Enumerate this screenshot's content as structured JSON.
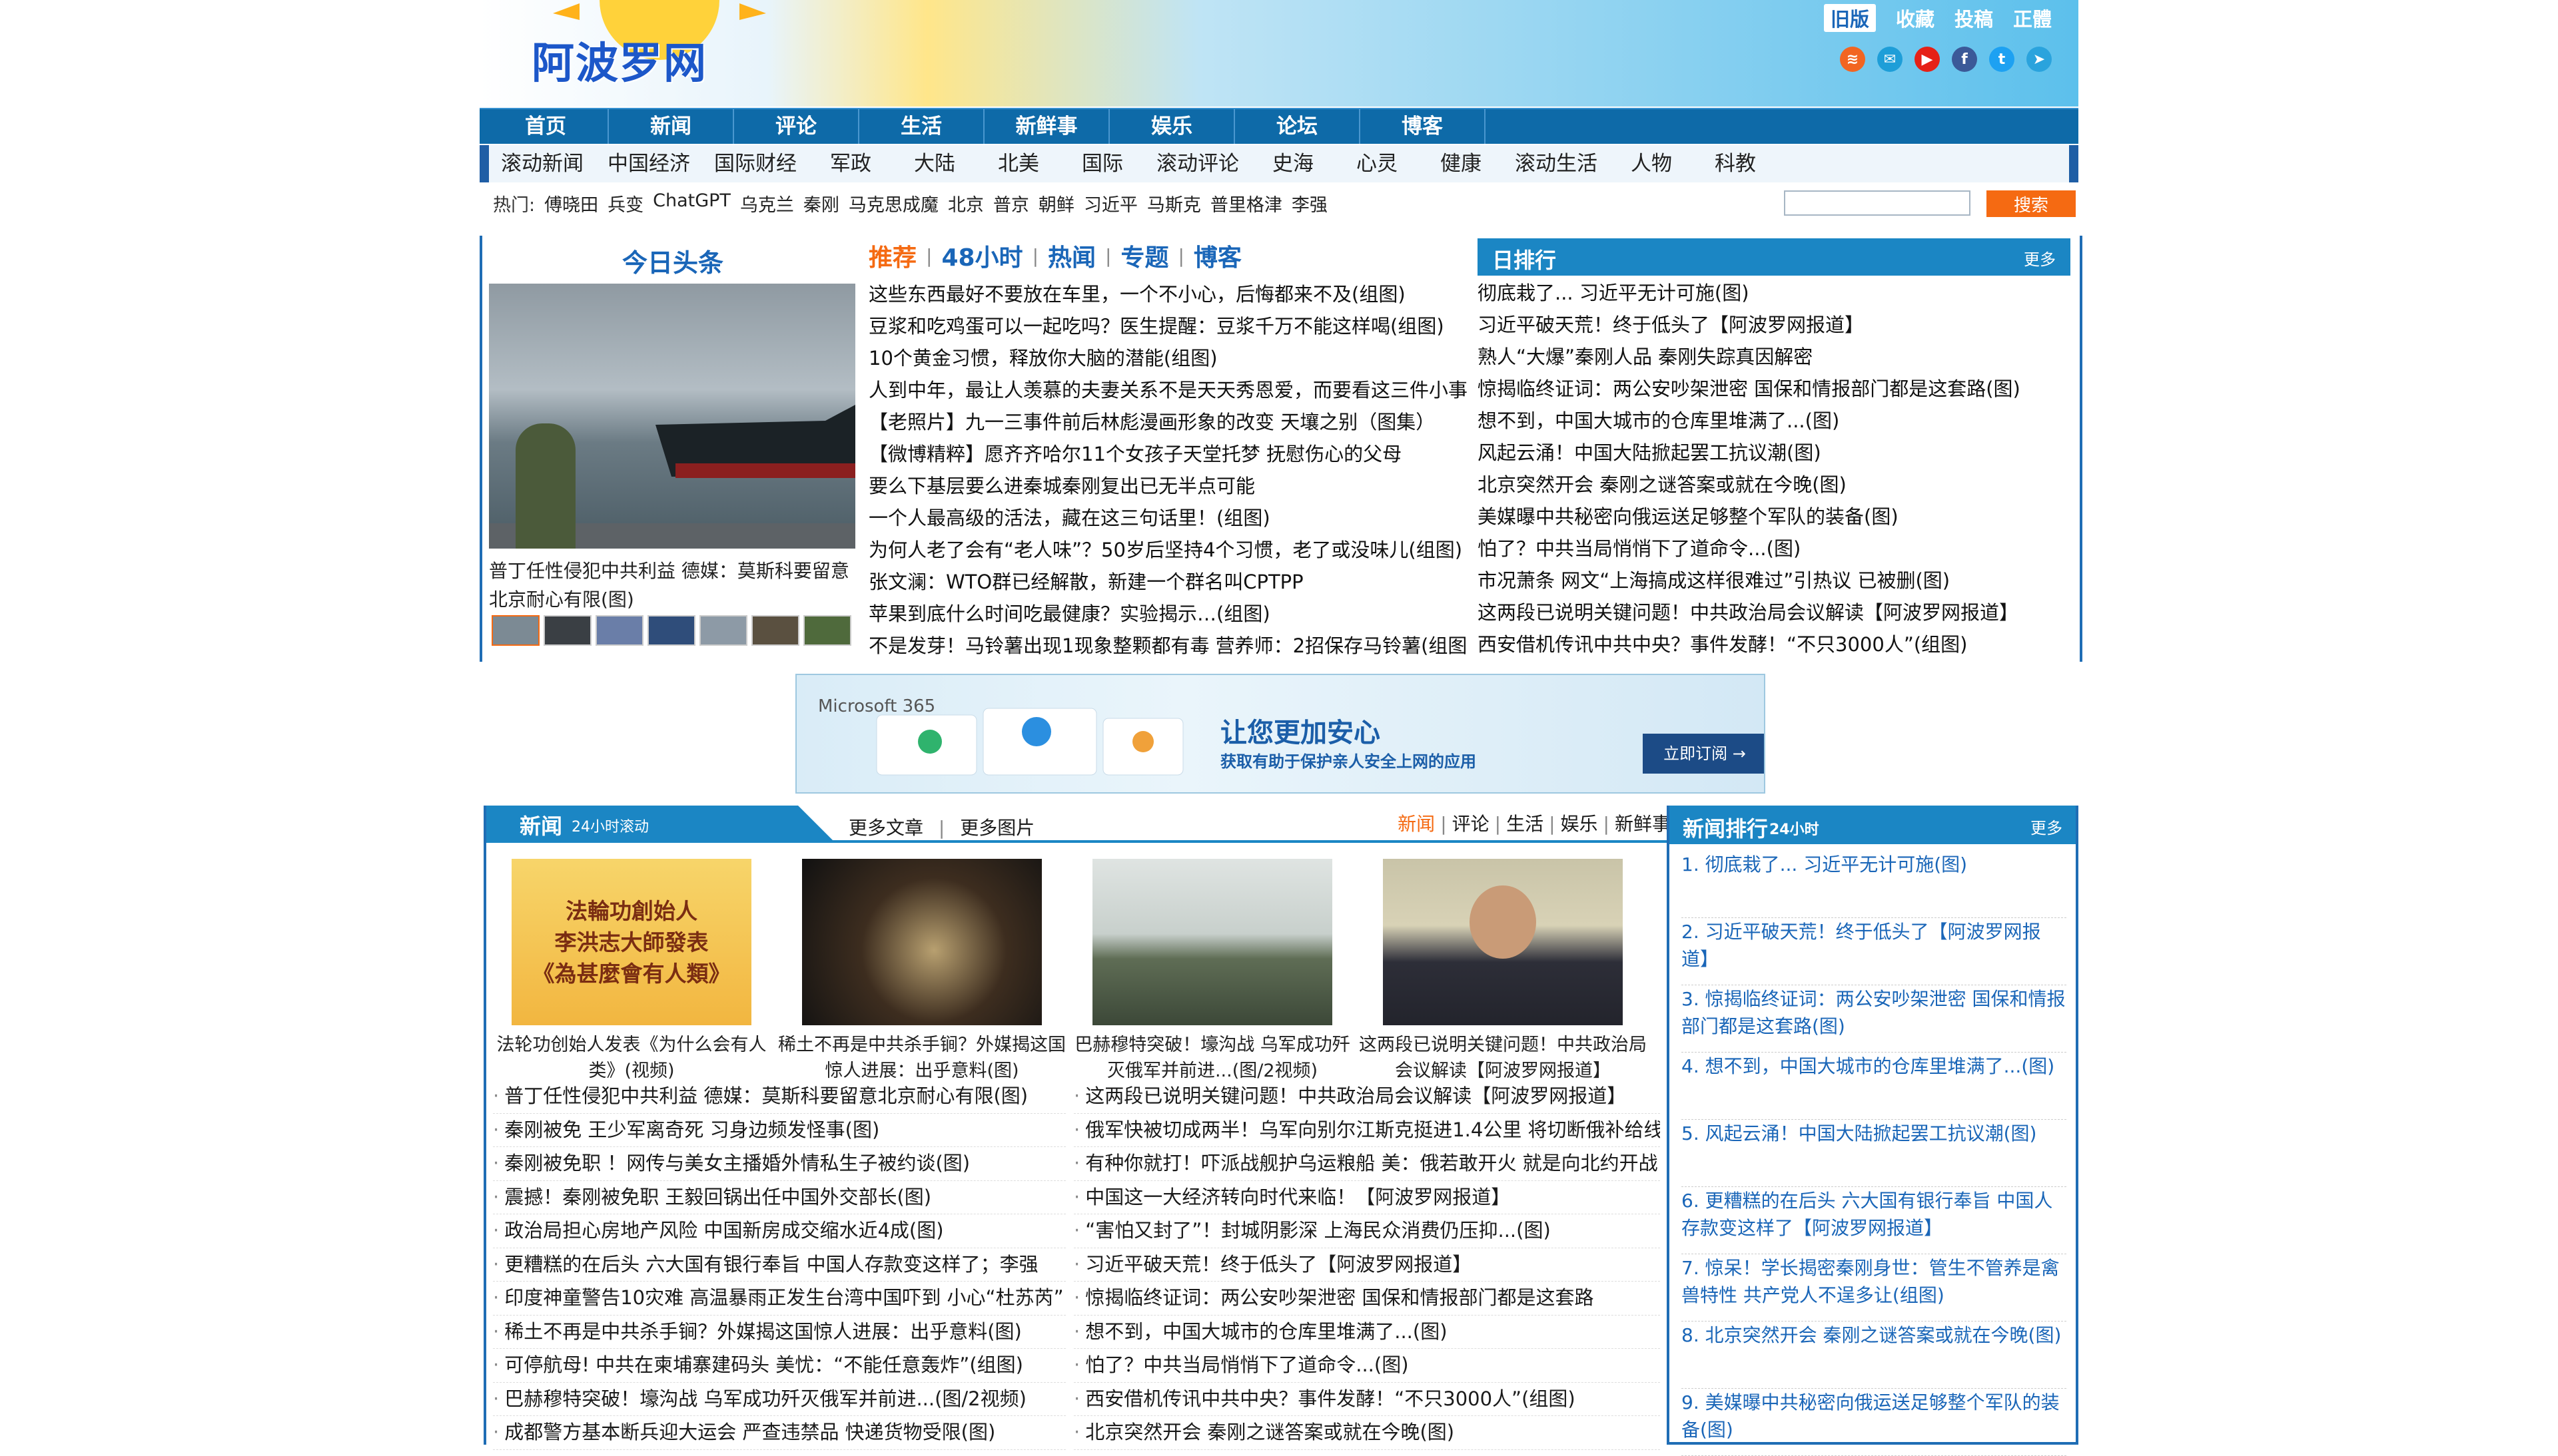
{
  "header": {
    "logo": "阿波罗网",
    "toplinks": [
      "旧版",
      "收藏",
      "投稿",
      "正體"
    ],
    "socials": [
      {
        "icon": "rss-icon",
        "glyph": "≋",
        "color": "#f26522"
      },
      {
        "icon": "telegram-circle-icon",
        "glyph": "✉",
        "color": "#1e9ed8"
      },
      {
        "icon": "youtube-icon",
        "glyph": "▶",
        "color": "#e62117"
      },
      {
        "icon": "facebook-icon",
        "glyph": "f",
        "color": "#3b5998"
      },
      {
        "icon": "twitter-icon",
        "glyph": "t",
        "color": "#1da1f2"
      },
      {
        "icon": "telegram-icon",
        "glyph": "➤",
        "color": "#2aa3dd"
      }
    ]
  },
  "nav": [
    "首页",
    "新闻",
    "评论",
    "生活",
    "新鲜事",
    "娱乐",
    "论坛",
    "博客"
  ],
  "subnav": [
    "滚动新闻",
    "中国经济",
    "国际财经",
    "军政",
    "大陆",
    "北美",
    "国际",
    "滚动评论",
    "史海",
    "心灵",
    "健康",
    "滚动生活",
    "人物",
    "科教"
  ],
  "hot": {
    "label": "热门:",
    "items": [
      "傅晓田",
      "兵变",
      "ChatGPT",
      "乌克兰",
      "秦刚",
      "马克思成魔",
      "北京",
      "普京",
      "朝鲜",
      "习近平",
      "马斯克",
      "普里格津",
      "李强"
    ],
    "search_button": "搜索"
  },
  "headline": {
    "title": "今日头条",
    "caption": "普丁任性侵犯中共利益 德媒：莫斯科要留意北京耐心有限(图)"
  },
  "mid": {
    "tabs": [
      "推荐",
      "48小时",
      "热闻",
      "专题",
      "博客"
    ],
    "items": [
      "这些东西最好不要放在车里，一个不小心，后悔都来不及(组图)",
      "豆浆和吃鸡蛋可以一起吃吗？医生提醒：豆浆千万不能这样喝(组图)",
      "10个黄金习惯，释放你大脑的潜能(组图)",
      "人到中年，最让人羡慕的夫妻关系不是天天秀恩爱，而要看这三件小事",
      "【老照片】九一三事件前后林彪漫画形象的改变 天壤之别（图集）",
      "【微博精粹】愿齐齐哈尔11个女孩子天堂托梦 抚慰伤心的父母",
      "要么下基层要么进秦城秦刚复出已无半点可能",
      "一个人最高级的活法，藏在这三句话里！(组图)",
      "为何人老了会有“老人味”？50岁后坚持4个习惯，老了或没味儿(组图)",
      "张文澜：WTO群已经解散，新建一个群名叫CPTPP",
      "苹果到底什么时间吃最健康？实验揭示…(组图)",
      "不是发芽！马铃薯出现1现象整颗都有毒 营养师：2招保存马铃薯(组图)"
    ]
  },
  "daily_rank": {
    "title": "日排行",
    "more": "更多",
    "items": [
      "彻底栽了... 习近平无计可施(图)",
      "习近平破天荒！终于低头了【阿波罗网报道】",
      "熟人“大爆”秦刚人品 秦刚失踪真因解密",
      "惊揭临终证词：两公安吵架泄密 国保和情报部门都是这套路(图)",
      "想不到，中国大城市的仓库里堆满了...(图)",
      "风起云涌！中国大陆掀起罢工抗议潮(图)",
      "北京突然开会 秦刚之谜答案或就在今晚(图)",
      "美媒曝中共秘密向俄运送足够整个军队的装备(图)",
      "怕了？中共当局悄悄下了道命令...(图)",
      "市况萧条 网文“上海搞成这样很难过”引热议 已被删(图)",
      "这两段已说明关键问题！中共政治局会议解读【阿波罗网报道】",
      "西安借机传讯中共中央？事件发酵！“不只3000人”(组图)"
    ]
  },
  "ad": {
    "brand": "Microsoft 365",
    "title": "让您更加安心",
    "subtitle": "获取有助于保护亲人安全上网的应用",
    "button": "立即订阅 →"
  },
  "news": {
    "tag": "新闻",
    "tag_sub": "24小时滚动",
    "more_articles": "更多文章",
    "more_images": "更多图片",
    "cats": [
      "新闻",
      "评论",
      "生活",
      "娱乐",
      "新鲜事"
    ],
    "images": [
      {
        "caption": "法轮功创始人发表《为什么会有人类》(视频)",
        "text": "法輪功創始人\n李洪志大師發表\n《為甚麼會有人類》"
      },
      {
        "caption": "稀土不再是中共杀手锏？外媒揭这国惊人进展：出乎意料(图)"
      },
      {
        "caption": "巴赫穆特突破！壕沟战 乌军成功歼灭俄军并前进...(图/2视频)"
      },
      {
        "caption": "这两段已说明关键问题！中共政治局会议解读【阿波罗网报道】"
      }
    ],
    "list_a": [
      "普丁任性侵犯中共利益 德媒：莫斯科要留意北京耐心有限(图)",
      "秦刚被免 王少军离奇死 习身边频发怪事(图)",
      "秦刚被免职 ！网传与美女主播婚外情私生子被约谈(图)",
      "震撼！秦刚被免职 王毅回锅出任中国外交部长(图)",
      "政治局担心房地产风险 中国新房成交缩水近4成(图)",
      "更糟糕的在后头 六大国有银行奉旨 中国人存款变这样了；李强",
      "印度神童警告10灾难 高温暴雨正发生台湾中国吓到 小心“杜苏芮”",
      "稀土不再是中共杀手锏？外媒揭这国惊人进展：出乎意料(图)",
      "可停航母! 中共在柬埔寨建码头 美忧：“不能任意轰炸”(组图)",
      "巴赫穆特突破！壕沟战 乌军成功歼灭俄军并前进...(图/2视频)",
      "成都警方基本断兵迎大运会 严查违禁品 快递货物受限(图)"
    ],
    "list_b": [
      "这两段已说明关键问题！中共政治局会议解读【阿波罗网报道】",
      "俄军快被切成两半！乌军向别尔江斯克挺进1.4公里 将切断俄补给线",
      "有种你就打！吓派战舰护乌运粮船 美：俄若敢开火 就是向北约开战",
      "中国这一大经济转向时代来临！【阿波罗网报道】",
      "“害怕又封了”！封城阴影深 上海民众消费仍压抑...(图)",
      "习近平破天荒！终于低头了【阿波罗网报道】",
      "惊揭临终证词：两公安吵架泄密 国保和情报部门都是这套路",
      "想不到，中国大城市的仓库里堆满了...(图)",
      "怕了？中共当局悄悄下了道命令...(图)",
      "西安借机传讯中共中央？事件发酵！“不只3000人”(组图)",
      "北京突然开会 秦刚之谜答案或就在今晚(图)"
    ]
  },
  "news_rank": {
    "title": "新闻排行",
    "sub": "24小时",
    "more": "更多",
    "items": [
      "1. 彻底栽了... 习近平无计可施(图)",
      "2. 习近平破天荒！终于低头了【阿波罗网报道】",
      "3. 惊揭临终证词：两公安吵架泄密 国保和情报部门都是这套路(图)",
      "4. 想不到，中国大城市的仓库里堆满了...(图)",
      "5. 风起云涌！中国大陆掀起罢工抗议潮(图)",
      "6. 更糟糕的在后头 六大国有银行奉旨 中国人存款变这样了【阿波罗网报道】",
      "7. 惊呆！学长揭密秦刚身世：管生不管养是禽兽特性 共产党人不逞多让(组图)",
      "8. 北京突然开会 秦刚之谜答案或就在今晚(图)",
      "9. 美媒曝中共秘密向俄运送足够整个军队的装备(图)"
    ]
  }
}
